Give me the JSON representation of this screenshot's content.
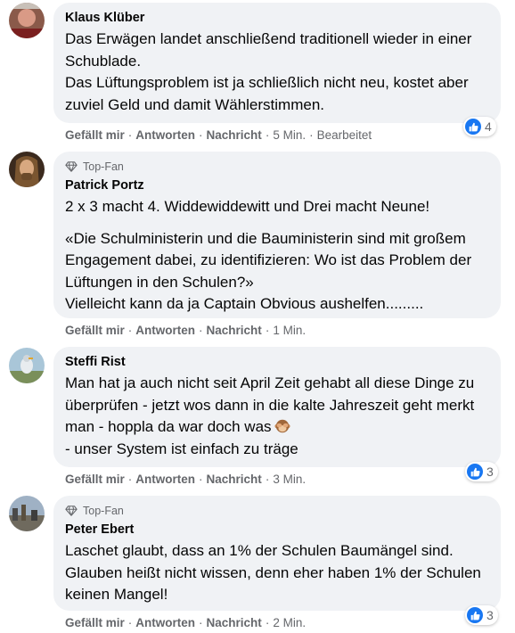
{
  "comments": [
    {
      "author": "Klaus Klüber",
      "top_fan_label": "",
      "paragraphs": [
        "Das Erwägen landet anschließend traditionell wieder in einer Schublade.",
        "Das Lüftungsproblem ist ja schließlich nicht neu, kostet aber zuviel Geld und damit Wählerstimmen."
      ],
      "like_label": "Gefällt mir",
      "reply_label": "Antworten",
      "message_label": "Nachricht",
      "time": "5 Min.",
      "edited": "Bearbeitet",
      "reaction_count": "4"
    },
    {
      "author": "Patrick Portz",
      "top_fan_label": "Top-Fan",
      "paragraphs": [
        "2 x 3 macht 4. Widdewiddewitt und Drei macht Neune!",
        "«Die Schulministerin und die Bauministerin sind mit großem Engagement dabei, zu identifizieren: Wo ist das Problem der Lüftungen in den Schulen?»",
        "Vielleicht kann da ja Captain Obvious aushelfen........."
      ],
      "like_label": "Gefällt mir",
      "reply_label": "Antworten",
      "message_label": "Nachricht",
      "time": "1 Min."
    },
    {
      "author": "Steffi Rist",
      "top_fan_label": "",
      "paragraphs": [
        "Man hat ja auch nicht seit April Zeit gehabt all diese Dinge zu überprüfen - jetzt wos dann in die kalte Jahreszeit geht merkt man - hoppla da war doch was",
        "- unser System ist einfach zu träge"
      ],
      "emoji_icon": "see-no-evil-monkey-icon",
      "like_label": "Gefällt mir",
      "reply_label": "Antworten",
      "message_label": "Nachricht",
      "time": "3 Min.",
      "reaction_count": "3"
    },
    {
      "author": "Peter Ebert",
      "top_fan_label": "Top-Fan",
      "paragraphs": [
        "Laschet glaubt, dass an 1% der Schulen Baumängel sind. Glauben heißt nicht wissen, denn eher haben 1% der Schulen keinen Mangel!"
      ],
      "like_label": "Gefällt mir",
      "reply_label": "Antworten",
      "message_label": "Nachricht",
      "time": "2 Min.",
      "reaction_count": "3"
    }
  ],
  "colors": {
    "bubble_bg": "#f0f2f5",
    "meta_text": "#65676b",
    "like_blue": "#1877f2"
  }
}
